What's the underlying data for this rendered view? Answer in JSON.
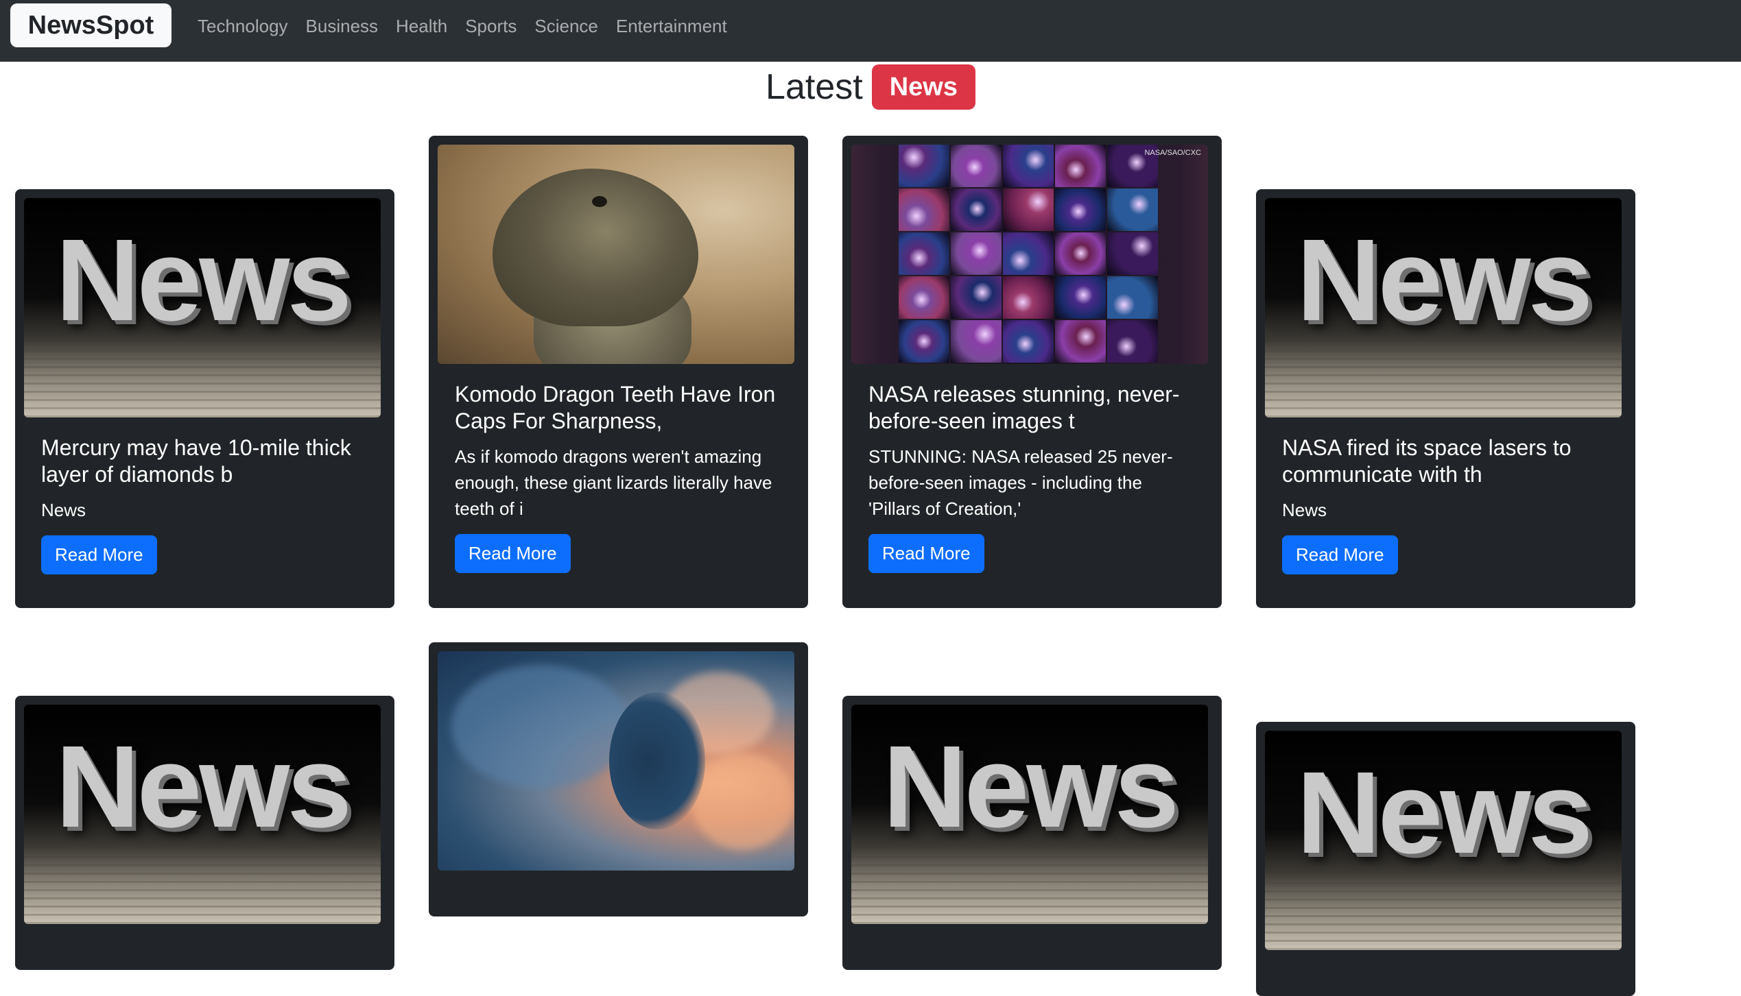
{
  "navbar": {
    "brand": "NewsSpot",
    "links": [
      "Technology",
      "Business",
      "Health",
      "Sports",
      "Science",
      "Entertainment"
    ]
  },
  "heading": {
    "text": "Latest",
    "badge": "News"
  },
  "image_placeholder_word": "News",
  "nasa_credit": "NASA/SAO/CXC",
  "cards": [
    {
      "title": "Mercury may have 10-mile thick layer of diamonds b",
      "description": "News",
      "button": "Read More",
      "image": "news-placeholder-image"
    },
    {
      "title": "Komodo Dragon Teeth Have Iron Caps For Sharpness,",
      "description": "As if komodo dragons weren't amazing enough, these giant lizards literally have teeth of i",
      "button": "Read More",
      "image": "komodo-dragon-image"
    },
    {
      "title": "NASA releases stunning, never-before-seen images t",
      "description": "STUNNING: NASA released 25 never-before-seen images - including the 'Pillars of Creation,'",
      "button": "Read More",
      "image": "nasa-galaxy-grid-image"
    },
    {
      "title": "NASA fired its space lasers to communicate with th",
      "description": "News",
      "button": "Read More",
      "image": "news-placeholder-image"
    }
  ],
  "second_row_images": [
    "news-placeholder-image",
    "smoke-face-image",
    "news-placeholder-image",
    "news-placeholder-image"
  ],
  "colors": {
    "navbar_bg": "#2b3035",
    "card_bg": "#212529",
    "button_bg": "#0d6efd",
    "badge_bg": "#dc3545"
  }
}
